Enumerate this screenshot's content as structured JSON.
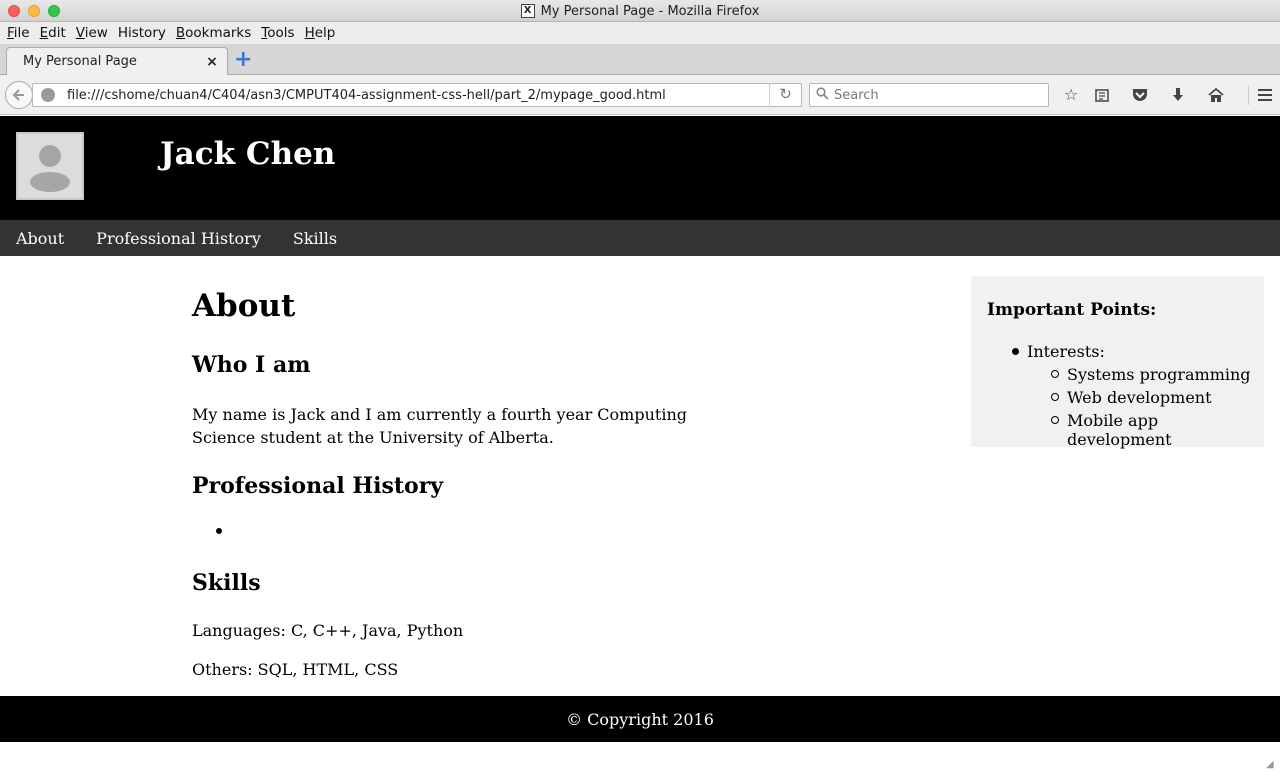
{
  "window": {
    "title": "My Personal Page - Mozilla Firefox"
  },
  "menubar": {
    "items": [
      {
        "first": "F",
        "rest": "ile"
      },
      {
        "first": "E",
        "rest": "dit"
      },
      {
        "first": "V",
        "rest": "iew"
      },
      {
        "first": "",
        "rest": "History"
      },
      {
        "first": "B",
        "rest": "ookmarks"
      },
      {
        "first": "T",
        "rest": "ools"
      },
      {
        "first": "H",
        "rest": "elp"
      }
    ]
  },
  "tabs": {
    "active_label": "My Personal Page",
    "close_glyph": "×",
    "new_tab_glyph": "+"
  },
  "navbar": {
    "url": "file:///cshome/chuan4/C404/asn3/CMPUT404-assignment-css-hell/part_2/mypage_good.html",
    "search_placeholder": "Search",
    "icons": [
      "back-arrow-icon",
      "globe-icon",
      "reload-icon",
      "search-icon",
      "star-icon",
      "reading-list-icon",
      "pocket-icon",
      "download-icon",
      "home-icon",
      "menu-icon"
    ]
  },
  "site": {
    "name": "Jack Chen",
    "nav": [
      "About",
      "Professional History",
      "Skills"
    ]
  },
  "main": {
    "heading": "About",
    "who_heading": "Who I am",
    "who_text": "My name is Jack and I am currently a fourth year Computing Science student at the University of Alberta.",
    "prof_heading": "Professional History",
    "skills_heading": "Skills",
    "languages": "Languages: C, C++, Java, Python",
    "others": "Others: SQL, HTML, CSS"
  },
  "aside": {
    "title": "Important Points:",
    "interests_label": "Interests:",
    "interests": [
      "Systems programming",
      "Web development",
      "Mobile app development"
    ]
  },
  "footer": {
    "text": "© Copyright 2016"
  }
}
